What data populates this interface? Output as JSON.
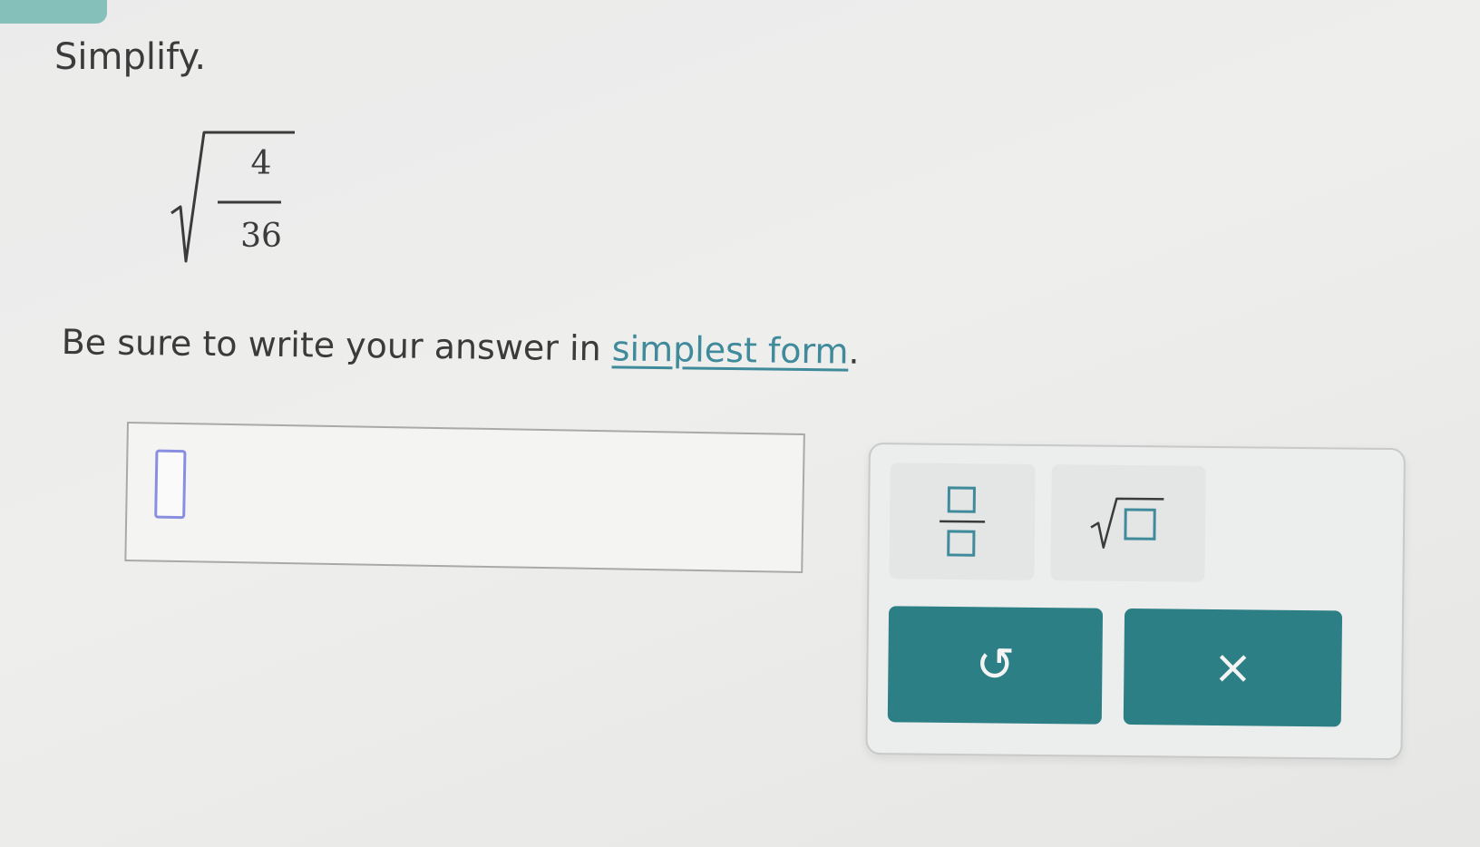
{
  "problem": {
    "instruction": "Simplify.",
    "expression": {
      "numerator": "4",
      "denominator": "36"
    },
    "note_prefix": "Be sure to write your answer in ",
    "note_link": "simplest form",
    "note_suffix": "."
  },
  "answer": {
    "value": ""
  },
  "keypad": {
    "tools": [
      {
        "name": "fraction",
        "icon": "fraction-template-icon"
      },
      {
        "name": "square-root",
        "icon": "sqrt-template-icon"
      }
    ],
    "actions": {
      "undo_icon": "undo-icon",
      "undo_glyph": "↺",
      "clear_icon": "close-icon",
      "clear_glyph": "×"
    }
  },
  "colors": {
    "accent": "#2d7f86",
    "link": "#3f8a9b",
    "cursor": "#8a8ee0"
  }
}
